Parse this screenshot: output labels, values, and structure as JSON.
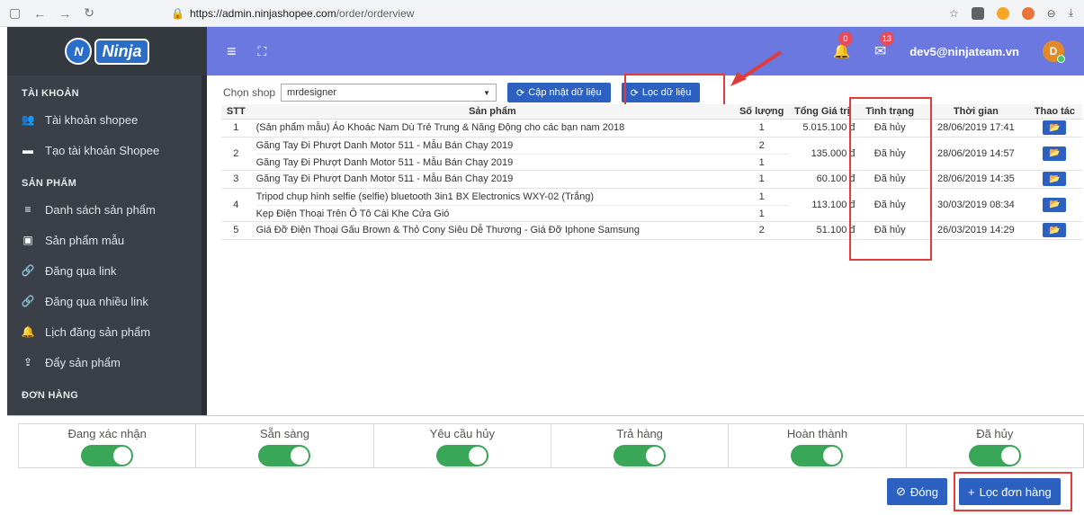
{
  "browser": {
    "url_host": "https://admin.ninjashopee.com",
    "url_path": "/order/orderview"
  },
  "logo": {
    "text": "Ninja",
    "mark": "N"
  },
  "header": {
    "notif_count": "0",
    "mail_count": "13",
    "user_email": "dev5@ninjateam.vn",
    "avatar_letter": "D"
  },
  "sidebar": {
    "sections": [
      {
        "title": "TÀI KHOẢN",
        "items": [
          {
            "label": "Tài khoản shopee",
            "icon": "users-icon"
          },
          {
            "label": "Tạo tài khoản Shopee",
            "icon": "card-icon"
          }
        ]
      },
      {
        "title": "SẢN PHẨM",
        "items": [
          {
            "label": "Danh sách sản phẩm",
            "icon": "list-icon"
          },
          {
            "label": "Sản phẩm mẫu",
            "icon": "template-icon"
          },
          {
            "label": "Đăng qua link",
            "icon": "link-icon"
          },
          {
            "label": "Đăng qua nhiều link",
            "icon": "links-icon"
          },
          {
            "label": "Lịch đăng sản phẩm",
            "icon": "bell-icon"
          },
          {
            "label": "Đẩy sản phẩm",
            "icon": "upload-icon"
          }
        ]
      },
      {
        "title": "ĐƠN HÀNG",
        "items": []
      }
    ]
  },
  "filter": {
    "shop_label": "Chọn shop",
    "shop_value": "mrdesigner",
    "update_btn": "Cập nhật dữ liệu",
    "filter_btn": "Lọc dữ liệu"
  },
  "table": {
    "headers": [
      "STT",
      "Sản phẩm",
      "Số lượng",
      "Tổng Giá trị",
      "Tình trạng",
      "Thời gian",
      "Thao tác"
    ],
    "rows": [
      {
        "stt": "1",
        "products": [
          "(Sản phẩm mẫu) Áo Khoác Nam Dù Trẻ Trung & Năng Động cho các bạn nam 2018"
        ],
        "qty": [
          "1"
        ],
        "total": "5.015.100 đ",
        "status": "Đã hủy",
        "time": "28/06/2019 17:41"
      },
      {
        "stt": "2",
        "products": [
          "Găng Tay Đi Phượt Danh Motor 511 - Mẫu Bán Chạy 2019",
          "Găng Tay Đi Phượt Danh Motor 511 - Mẫu Bán Chạy 2019"
        ],
        "qty": [
          "2",
          "1"
        ],
        "total": "135.000 đ",
        "status": "Đã hủy",
        "time": "28/06/2019 14:57"
      },
      {
        "stt": "3",
        "products": [
          "Găng Tay Đi Phượt Danh Motor 511 - Mẫu Bán Chạy 2019"
        ],
        "qty": [
          "1"
        ],
        "total": "60.100 đ",
        "status": "Đã hủy",
        "time": "28/06/2019 14:35"
      },
      {
        "stt": "4",
        "products": [
          "Tripod chụp hình selfie (selfie) bluetooth 3in1 BX Electronics WXY-02 (Trắng)",
          "Kẹp Điện Thoại Trên Ô Tô Cài Khe Cửa Gió"
        ],
        "qty": [
          "1",
          "1"
        ],
        "total": "113.100 đ",
        "status": "Đã hủy",
        "time": "30/03/2019 08:34"
      },
      {
        "stt": "5",
        "products": [
          "Giá Đỡ Điện Thoại Gấu Brown & Thỏ Cony Siêu Dễ Thương - Giá Đỡ Iphone Samsung"
        ],
        "qty": [
          "2"
        ],
        "total": "51.100 đ",
        "status": "Đã hủy",
        "time": "26/03/2019 14:29"
      }
    ]
  },
  "status_toggles": [
    {
      "label": "Đang xác nhận",
      "on": true
    },
    {
      "label": "Sẵn sàng",
      "on": true
    },
    {
      "label": "Yêu cầu hủy",
      "on": true
    },
    {
      "label": "Trả hàng",
      "on": true
    },
    {
      "label": "Hoàn thành",
      "on": true
    },
    {
      "label": "Đã hủy",
      "on": true
    }
  ],
  "actions": {
    "close_btn": "Đóng",
    "filter_orders_btn": "Lọc đơn hàng"
  },
  "colors": {
    "header": "#6a78e0",
    "sidebar": "#3b4048",
    "primary": "#2c61c1",
    "toggle_on": "#3aa657",
    "highlight": "#e23b3b"
  }
}
